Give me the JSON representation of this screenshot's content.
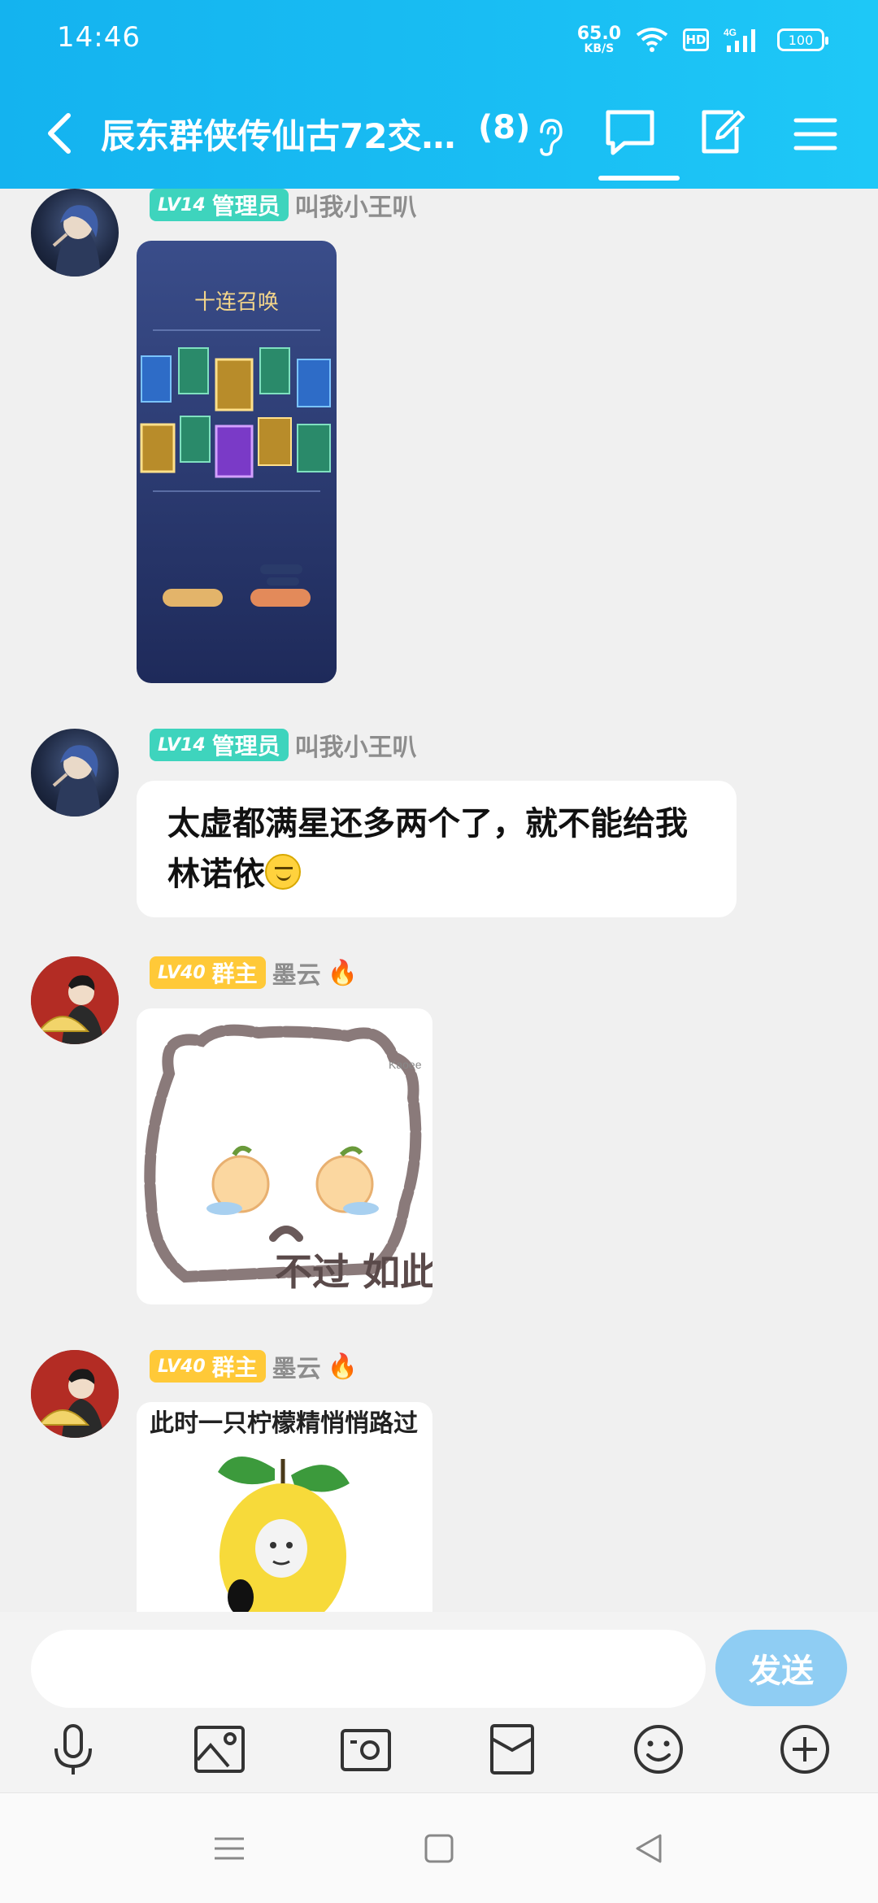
{
  "status_bar": {
    "time": "14:46",
    "net_speed_value": "65.0",
    "net_speed_unit": "KB/S",
    "hd_label": "HD",
    "network_label": "4G",
    "battery_level": "100"
  },
  "header": {
    "group_title": "辰东群侠传仙古72交…",
    "member_count": "(8)",
    "colors": {
      "gradient_start": "#14b3ef",
      "gradient_end": "#1ec8f7"
    }
  },
  "messages": [
    {
      "id": 1,
      "kind": "image",
      "level": "LV14",
      "role": "管理员",
      "sender": "叫我小王叭",
      "image_desc": "game-screenshot"
    },
    {
      "id": 2,
      "kind": "text",
      "level": "LV14",
      "role": "管理员",
      "sender": "叫我小王叭",
      "text": "太虚都满星还多两个了，就不能给我林诺依"
    },
    {
      "id": 3,
      "kind": "sticker",
      "level": "LV40",
      "role": "群主",
      "sender": "墨云",
      "sticker_text": "不过 如此",
      "sticker_watermark": "Kaoee"
    },
    {
      "id": 4,
      "kind": "sticker",
      "level": "LV40",
      "role": "群主",
      "sender": "墨云",
      "sticker_text": "此时一只柠檬精悄悄路过"
    }
  ],
  "game_card": {
    "banner": "十连召唤"
  },
  "input": {
    "value": "",
    "send_label": "发送"
  },
  "toolbar_icons": [
    "microphone-icon",
    "image-icon",
    "camera-icon",
    "red-packet-icon",
    "emoji-icon",
    "plus-icon"
  ],
  "system_nav": [
    "menu-icon",
    "home-icon",
    "back-icon"
  ]
}
